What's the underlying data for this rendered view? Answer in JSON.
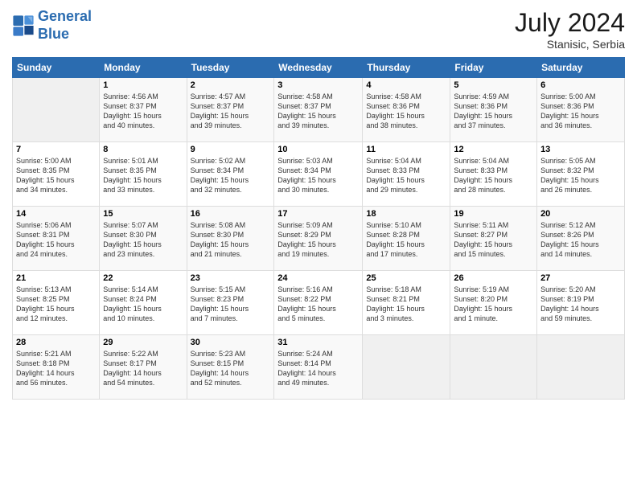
{
  "header": {
    "logo_line1": "General",
    "logo_line2": "Blue",
    "month_year": "July 2024",
    "location": "Stanisic, Serbia"
  },
  "weekdays": [
    "Sunday",
    "Monday",
    "Tuesday",
    "Wednesday",
    "Thursday",
    "Friday",
    "Saturday"
  ],
  "weeks": [
    [
      {
        "num": "",
        "info": ""
      },
      {
        "num": "1",
        "info": "Sunrise: 4:56 AM\nSunset: 8:37 PM\nDaylight: 15 hours\nand 40 minutes."
      },
      {
        "num": "2",
        "info": "Sunrise: 4:57 AM\nSunset: 8:37 PM\nDaylight: 15 hours\nand 39 minutes."
      },
      {
        "num": "3",
        "info": "Sunrise: 4:58 AM\nSunset: 8:37 PM\nDaylight: 15 hours\nand 39 minutes."
      },
      {
        "num": "4",
        "info": "Sunrise: 4:58 AM\nSunset: 8:36 PM\nDaylight: 15 hours\nand 38 minutes."
      },
      {
        "num": "5",
        "info": "Sunrise: 4:59 AM\nSunset: 8:36 PM\nDaylight: 15 hours\nand 37 minutes."
      },
      {
        "num": "6",
        "info": "Sunrise: 5:00 AM\nSunset: 8:36 PM\nDaylight: 15 hours\nand 36 minutes."
      }
    ],
    [
      {
        "num": "7",
        "info": "Sunrise: 5:00 AM\nSunset: 8:35 PM\nDaylight: 15 hours\nand 34 minutes."
      },
      {
        "num": "8",
        "info": "Sunrise: 5:01 AM\nSunset: 8:35 PM\nDaylight: 15 hours\nand 33 minutes."
      },
      {
        "num": "9",
        "info": "Sunrise: 5:02 AM\nSunset: 8:34 PM\nDaylight: 15 hours\nand 32 minutes."
      },
      {
        "num": "10",
        "info": "Sunrise: 5:03 AM\nSunset: 8:34 PM\nDaylight: 15 hours\nand 30 minutes."
      },
      {
        "num": "11",
        "info": "Sunrise: 5:04 AM\nSunset: 8:33 PM\nDaylight: 15 hours\nand 29 minutes."
      },
      {
        "num": "12",
        "info": "Sunrise: 5:04 AM\nSunset: 8:33 PM\nDaylight: 15 hours\nand 28 minutes."
      },
      {
        "num": "13",
        "info": "Sunrise: 5:05 AM\nSunset: 8:32 PM\nDaylight: 15 hours\nand 26 minutes."
      }
    ],
    [
      {
        "num": "14",
        "info": "Sunrise: 5:06 AM\nSunset: 8:31 PM\nDaylight: 15 hours\nand 24 minutes."
      },
      {
        "num": "15",
        "info": "Sunrise: 5:07 AM\nSunset: 8:30 PM\nDaylight: 15 hours\nand 23 minutes."
      },
      {
        "num": "16",
        "info": "Sunrise: 5:08 AM\nSunset: 8:30 PM\nDaylight: 15 hours\nand 21 minutes."
      },
      {
        "num": "17",
        "info": "Sunrise: 5:09 AM\nSunset: 8:29 PM\nDaylight: 15 hours\nand 19 minutes."
      },
      {
        "num": "18",
        "info": "Sunrise: 5:10 AM\nSunset: 8:28 PM\nDaylight: 15 hours\nand 17 minutes."
      },
      {
        "num": "19",
        "info": "Sunrise: 5:11 AM\nSunset: 8:27 PM\nDaylight: 15 hours\nand 15 minutes."
      },
      {
        "num": "20",
        "info": "Sunrise: 5:12 AM\nSunset: 8:26 PM\nDaylight: 15 hours\nand 14 minutes."
      }
    ],
    [
      {
        "num": "21",
        "info": "Sunrise: 5:13 AM\nSunset: 8:25 PM\nDaylight: 15 hours\nand 12 minutes."
      },
      {
        "num": "22",
        "info": "Sunrise: 5:14 AM\nSunset: 8:24 PM\nDaylight: 15 hours\nand 10 minutes."
      },
      {
        "num": "23",
        "info": "Sunrise: 5:15 AM\nSunset: 8:23 PM\nDaylight: 15 hours\nand 7 minutes."
      },
      {
        "num": "24",
        "info": "Sunrise: 5:16 AM\nSunset: 8:22 PM\nDaylight: 15 hours\nand 5 minutes."
      },
      {
        "num": "25",
        "info": "Sunrise: 5:18 AM\nSunset: 8:21 PM\nDaylight: 15 hours\nand 3 minutes."
      },
      {
        "num": "26",
        "info": "Sunrise: 5:19 AM\nSunset: 8:20 PM\nDaylight: 15 hours\nand 1 minute."
      },
      {
        "num": "27",
        "info": "Sunrise: 5:20 AM\nSunset: 8:19 PM\nDaylight: 14 hours\nand 59 minutes."
      }
    ],
    [
      {
        "num": "28",
        "info": "Sunrise: 5:21 AM\nSunset: 8:18 PM\nDaylight: 14 hours\nand 56 minutes."
      },
      {
        "num": "29",
        "info": "Sunrise: 5:22 AM\nSunset: 8:17 PM\nDaylight: 14 hours\nand 54 minutes."
      },
      {
        "num": "30",
        "info": "Sunrise: 5:23 AM\nSunset: 8:15 PM\nDaylight: 14 hours\nand 52 minutes."
      },
      {
        "num": "31",
        "info": "Sunrise: 5:24 AM\nSunset: 8:14 PM\nDaylight: 14 hours\nand 49 minutes."
      },
      {
        "num": "",
        "info": ""
      },
      {
        "num": "",
        "info": ""
      },
      {
        "num": "",
        "info": ""
      }
    ]
  ]
}
